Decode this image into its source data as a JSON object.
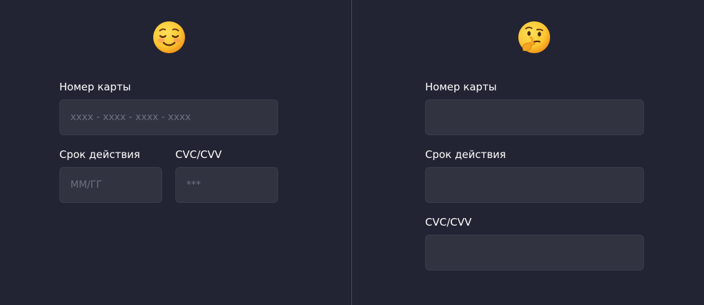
{
  "left_form": {
    "emoji": "smiling-face-icon",
    "card_number": {
      "label": "Номер карты",
      "placeholder": "xxxx - xxxx - xxxx - xxxx",
      "value": ""
    },
    "expiry": {
      "label": "Срок действия",
      "placeholder": "ММ/ГГ",
      "value": ""
    },
    "cvc": {
      "label": "CVC/CVV",
      "placeholder": "***",
      "value": ""
    }
  },
  "right_form": {
    "emoji": "thinking-face-icon",
    "card_number": {
      "label": "Номер карты",
      "placeholder": "",
      "value": ""
    },
    "expiry": {
      "label": "Срок действия",
      "placeholder": "",
      "value": ""
    },
    "cvc": {
      "label": "CVC/CVV",
      "placeholder": "",
      "value": ""
    }
  },
  "colors": {
    "background": "#222433",
    "field_background": "#313341",
    "field_border": "#3a3c4b",
    "label_text": "#ffffff",
    "placeholder_text": "#6e7080",
    "divider": "#4a4c5a"
  }
}
